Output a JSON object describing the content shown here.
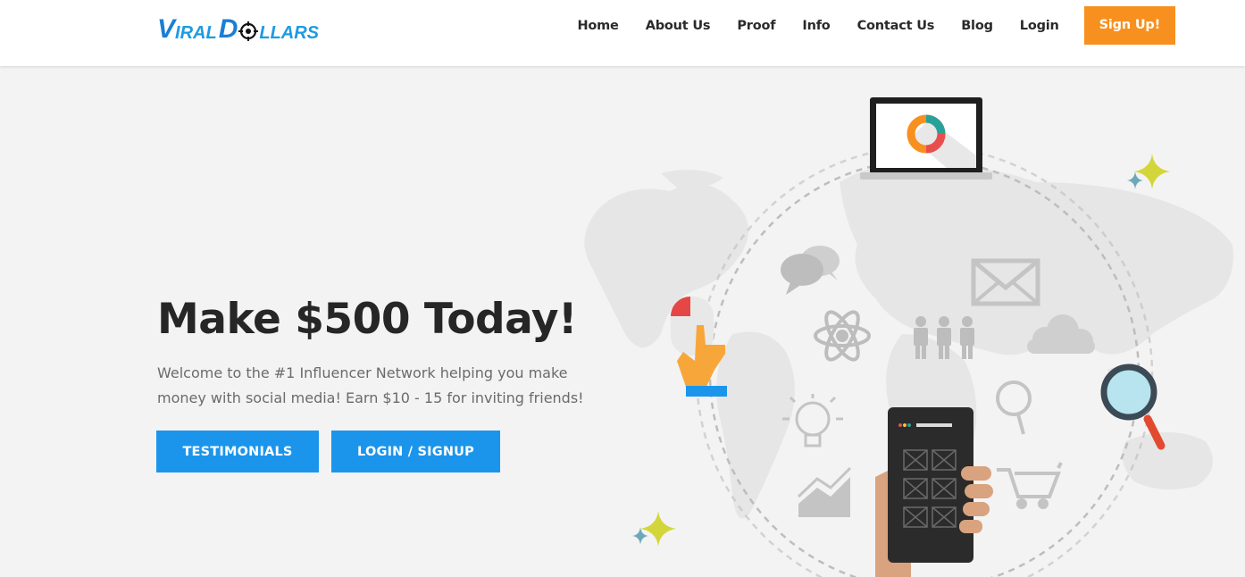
{
  "brand": {
    "logo_part1_big": "V",
    "logo_part1_small": "IRAL",
    "logo_part2_big": "D",
    "logo_part2_small": "LLARS"
  },
  "nav": {
    "items": [
      {
        "label": "Home"
      },
      {
        "label": "About Us"
      },
      {
        "label": "Proof"
      },
      {
        "label": "Info"
      },
      {
        "label": "Contact Us"
      },
      {
        "label": "Blog"
      },
      {
        "label": "Login"
      }
    ],
    "signup_label": "Sign Up!"
  },
  "hero": {
    "title": "Make $500 Today!",
    "subtitle": "Welcome to the #1 Influencer Network helping you make money with social media! Earn $10 - 15 for inviting friends!",
    "button_testimonials": "TESTIMONIALS",
    "button_login": "LOGIN / SIGNUP"
  },
  "colors": {
    "accent_orange": "#f7901e",
    "button_blue": "#1b95ec",
    "background": "#f3f3f3",
    "logo_blue": "#1a7fd4"
  },
  "icons": [
    "laptop-chart-icon",
    "chat-bubbles-icon",
    "mail-icon",
    "atom-icon",
    "people-icon",
    "cloud-icon",
    "magnifier-icon",
    "lightbulb-icon",
    "growth-chart-icon",
    "shopping-cart-icon",
    "mobile-phone-icon",
    "mouse-hand-icon",
    "sparkle-icon",
    "world-map-icon"
  ]
}
